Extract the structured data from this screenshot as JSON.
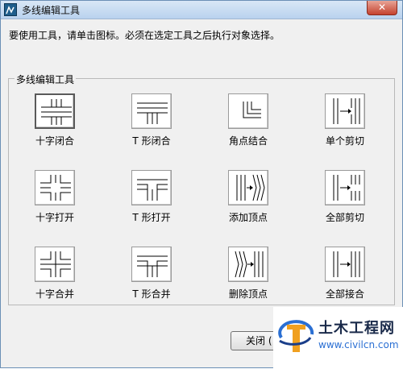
{
  "window": {
    "title": "多线编辑工具",
    "close_glyph": "✕"
  },
  "instruction": "要使用工具，请单击图标。必须在选定工具之后执行对象选择。",
  "group_label": "多线编辑工具",
  "tools": [
    {
      "label": "十字闭合",
      "icon": "cross-closed-icon"
    },
    {
      "label": "T 形闭合",
      "icon": "t-closed-icon"
    },
    {
      "label": "角点结合",
      "icon": "corner-joint-icon"
    },
    {
      "label": "单个剪切",
      "icon": "cut-single-icon"
    },
    {
      "label": "十字打开",
      "icon": "cross-open-icon"
    },
    {
      "label": "T 形打开",
      "icon": "t-open-icon"
    },
    {
      "label": "添加顶点",
      "icon": "add-vertex-icon"
    },
    {
      "label": "全部剪切",
      "icon": "cut-all-icon"
    },
    {
      "label": "十字合并",
      "icon": "cross-merged-icon"
    },
    {
      "label": "T 形合并",
      "icon": "t-merged-icon"
    },
    {
      "label": "删除顶点",
      "icon": "delete-vertex-icon"
    },
    {
      "label": "全部接合",
      "icon": "weld-all-icon"
    }
  ],
  "close_button": "关闭 (",
  "watermark": {
    "title": "土木工程网",
    "url": "www.civilcn.com"
  },
  "colors": {
    "titlebar": "#b9d2ee",
    "close": "#c5422f",
    "accent": "#2a6fd3"
  }
}
